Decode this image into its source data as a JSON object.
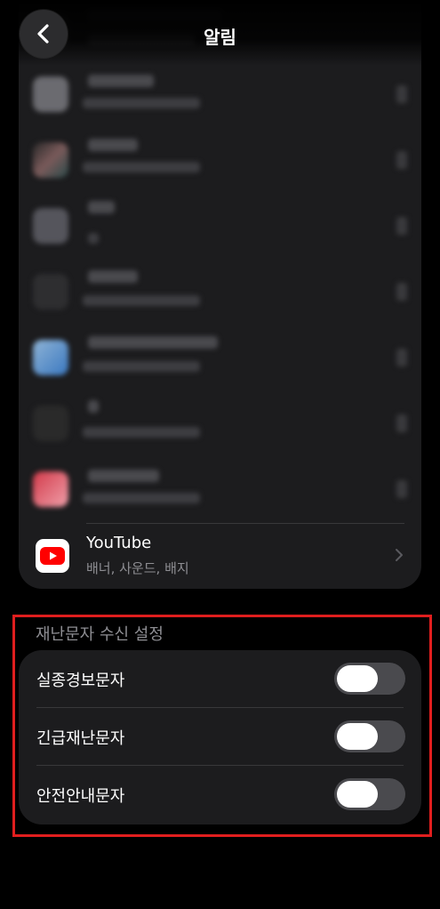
{
  "header": {
    "title": "알림",
    "back_icon": "chevron-left-icon"
  },
  "youtube": {
    "name": "YouTube",
    "subtitle": "배너, 사운드, 배지",
    "icon": "youtube-icon",
    "brand_color": "#ff0000"
  },
  "emergency": {
    "section_title": "재난문자 수신 설정",
    "items": [
      {
        "label": "실종경보문자",
        "enabled": false
      },
      {
        "label": "긴급재난문자",
        "enabled": false
      },
      {
        "label": "안전안내문자",
        "enabled": false
      }
    ]
  },
  "colors": {
    "background": "#000000",
    "card": "#1c1c1e",
    "secondary_text": "#8e8e93",
    "highlight_border": "#e01e1e"
  }
}
